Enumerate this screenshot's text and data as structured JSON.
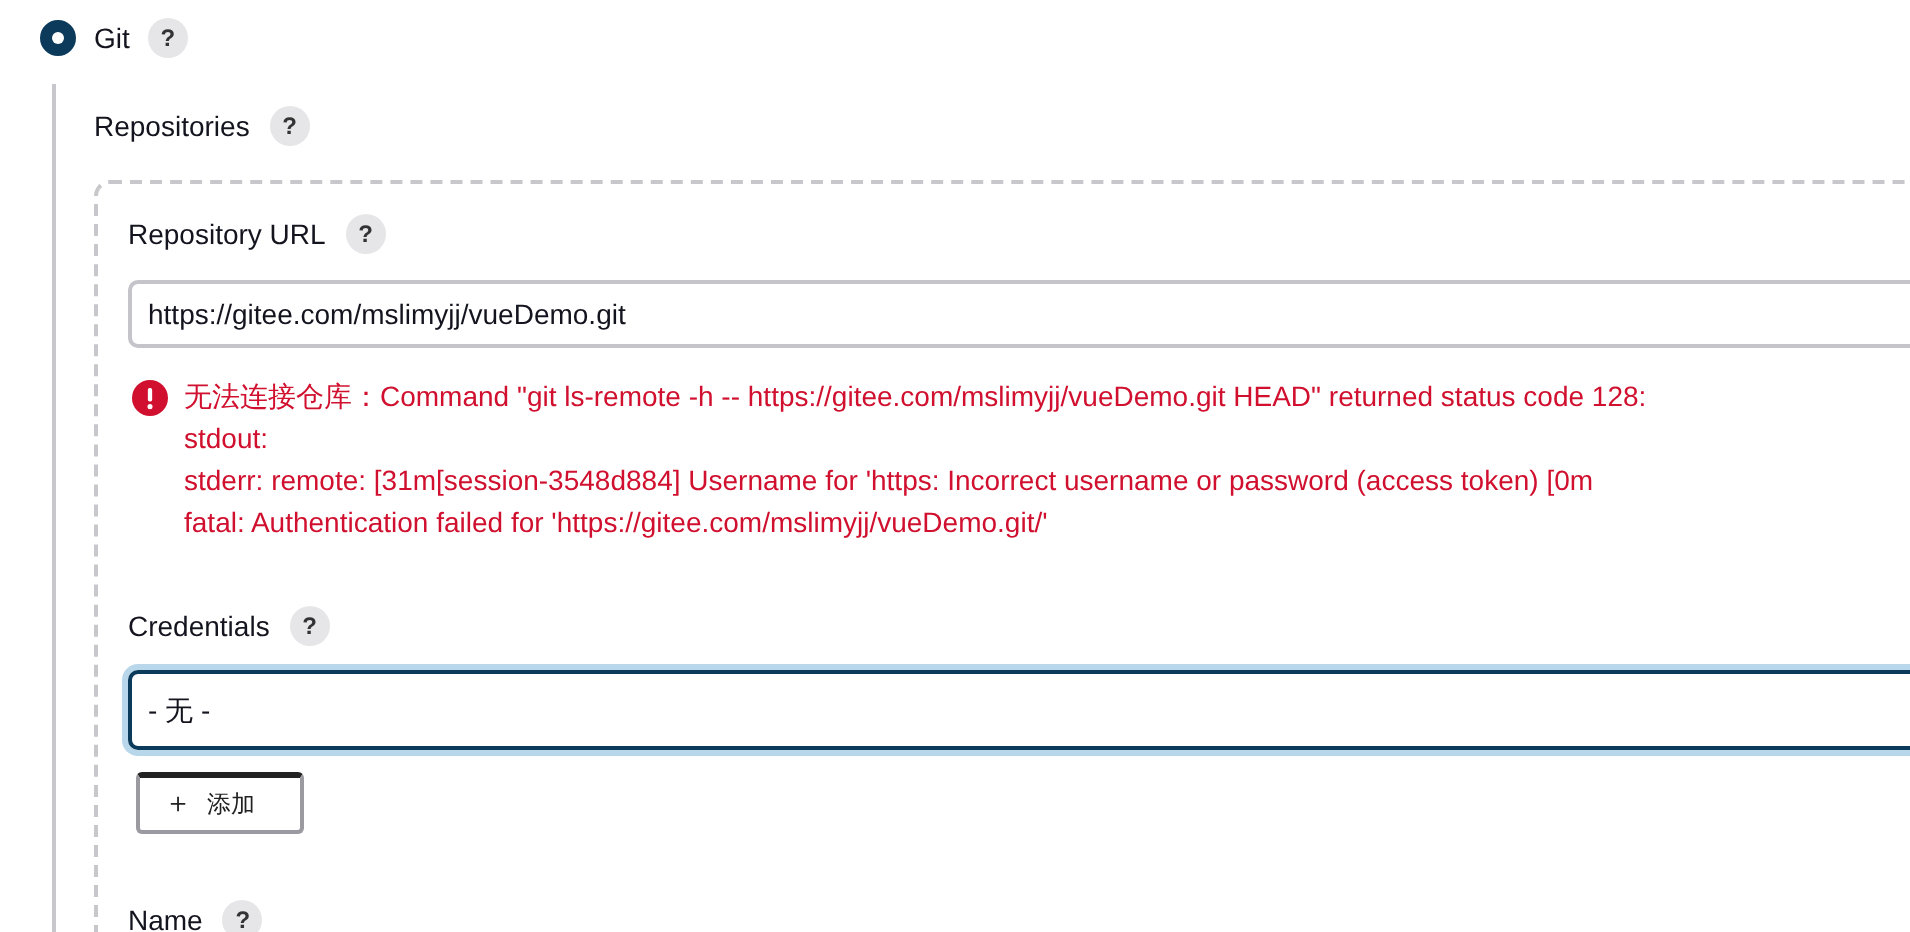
{
  "scm_option": {
    "label": "Git",
    "selected": true,
    "help": "?"
  },
  "repositories": {
    "label": "Repositories",
    "help": "?",
    "repository_url": {
      "label": "Repository URL",
      "help": "?",
      "value": "https://gitee.com/mslimyjj/vueDemo.git",
      "error": {
        "lines": [
          "无法连接仓库：Command \"git ls-remote -h -- https://gitee.com/mslimyjj/vueDemo.git HEAD\" returned status code 128:",
          "stdout:",
          "stderr: remote:  [31m[session-3548d884] Username for 'https: Incorrect username or password (access token) [0m",
          "fatal: Authentication failed for 'https://gitee.com/mslimyjj/vueDemo.git/'"
        ]
      }
    },
    "credentials": {
      "label": "Credentials",
      "help": "?",
      "value": "- 无 -",
      "focused": true,
      "add_button": {
        "icon": "＋",
        "label": "添加"
      }
    },
    "name": {
      "label": "Name",
      "help": "?"
    }
  }
}
